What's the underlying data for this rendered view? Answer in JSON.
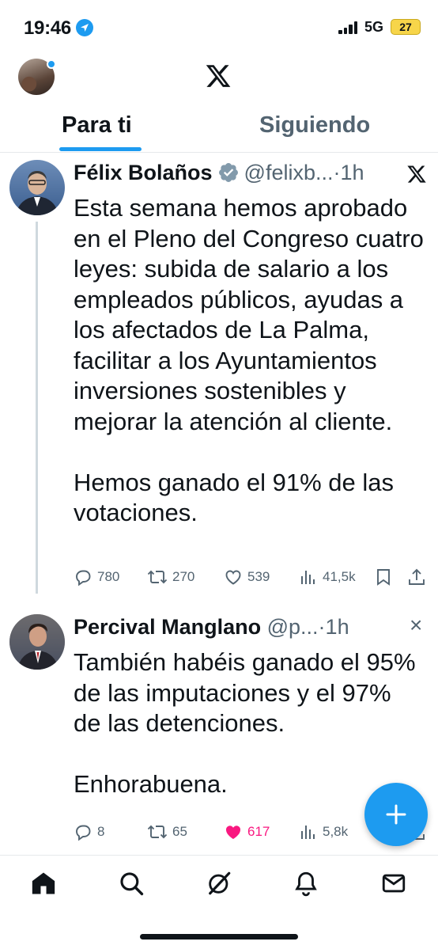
{
  "status_bar": {
    "time": "19:46",
    "network": "5G",
    "battery": "27"
  },
  "header": {
    "tabs": [
      {
        "label": "Para ti",
        "active": true
      },
      {
        "label": "Siguiendo",
        "active": false
      }
    ],
    "accent_color": "#1d9bf0"
  },
  "posts": [
    {
      "author": "Félix Bolaños",
      "verified": true,
      "handle": "@felixb...",
      "separator": "·",
      "time": "1h",
      "text": "Esta semana hemos aprobado\nen el Pleno del Congreso cuatro\nleyes: subida de salario a los\nempleados públicos, ayudas a\nlos afectados de La Palma,\nfacilitar a los Ayuntamientos\ninversiones sostenibles y\nmejorar la atención al cliente.\n\nHemos ganado el 91% de las\nvotaciones.",
      "replies": "780",
      "reposts": "270",
      "likes": "539",
      "views": "41,5k",
      "liked": false
    },
    {
      "author": "Percival Manglano",
      "verified": false,
      "handle": "@p...",
      "separator": "·",
      "time": "1h",
      "close": "×",
      "text": "También habéis ganado el 95%\nde las imputaciones y el 97%\nde las detenciones.\n\nEnhorabuena.",
      "replies": "8",
      "reposts": "65",
      "likes": "617",
      "views": "5,8k",
      "liked": true,
      "like_color": "#f91880"
    }
  ],
  "bottom_nav": {
    "items": [
      "home-icon",
      "search-icon",
      "grok-icon",
      "notifications-icon",
      "messages-icon"
    ]
  }
}
